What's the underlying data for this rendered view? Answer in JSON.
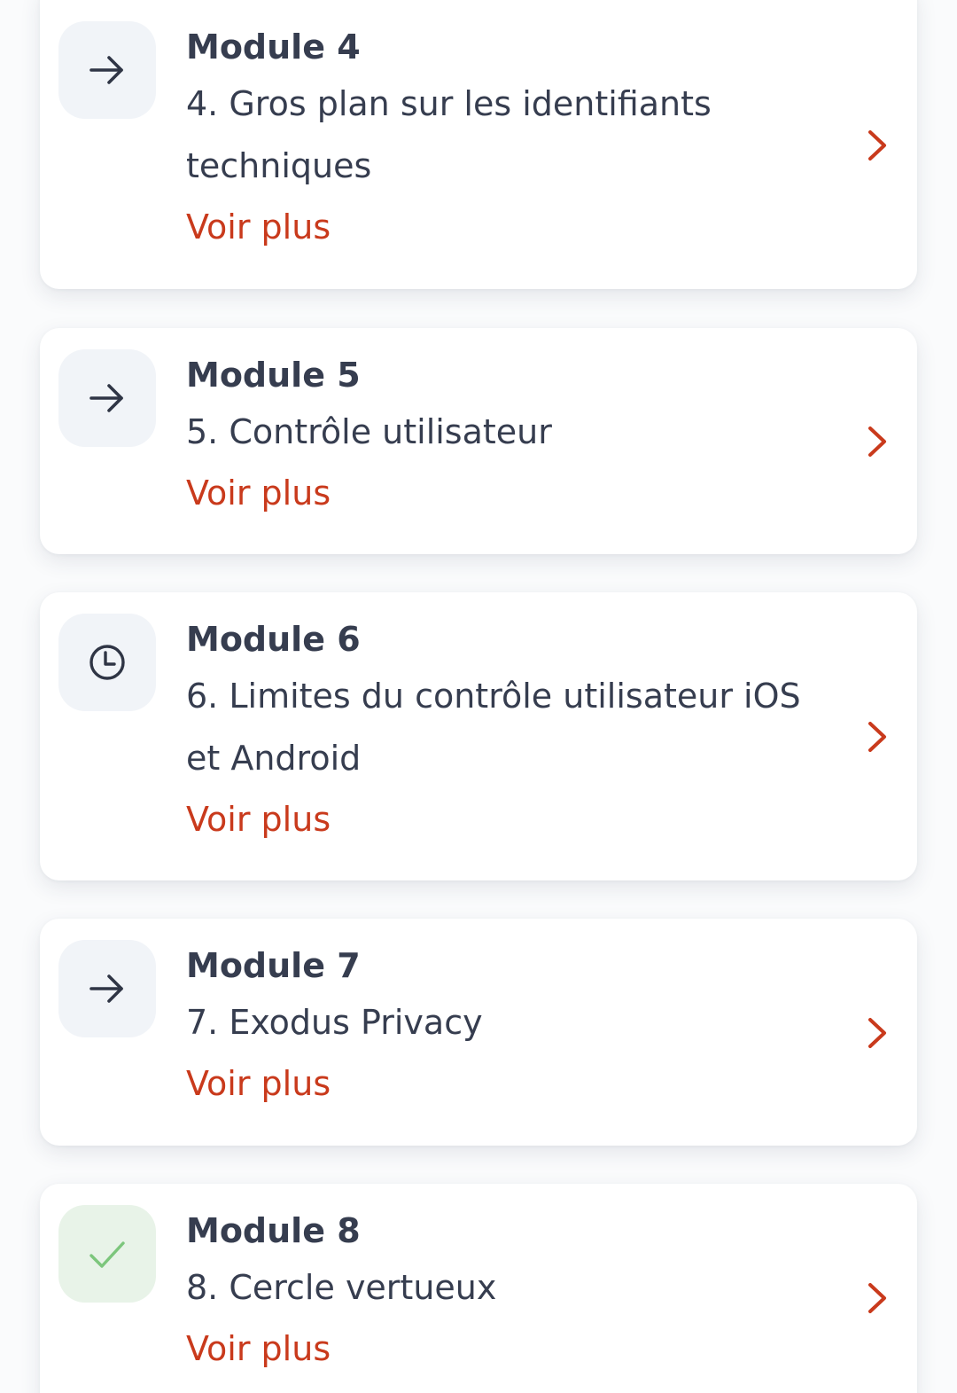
{
  "colors": {
    "accent": "#c93a1c",
    "text": "#363d4f",
    "badge_bg": "#f1f4f8",
    "done_badge_bg": "#e8f3e8",
    "done_check": "#7cc67c"
  },
  "modules": [
    {
      "title": "Module 4",
      "description": "4. Gros plan sur les identifiants techniques",
      "link": "Voir plus",
      "icon": "arrow-right-icon",
      "status": "available"
    },
    {
      "title": "Module 5",
      "description": "5. Contrôle utilisateur",
      "link": "Voir plus",
      "icon": "arrow-right-icon",
      "status": "available"
    },
    {
      "title": "Module 6",
      "description": "6. Limites du contrôle utilisateur iOS et Android",
      "link": "Voir plus",
      "icon": "clock-icon",
      "status": "pending"
    },
    {
      "title": "Module 7",
      "description": "7. Exodus Privacy",
      "link": "Voir plus",
      "icon": "arrow-right-icon",
      "status": "available"
    },
    {
      "title": "Module 8",
      "description": "8. Cercle vertueux",
      "link": "Voir plus",
      "icon": "check-icon",
      "status": "completed"
    }
  ]
}
